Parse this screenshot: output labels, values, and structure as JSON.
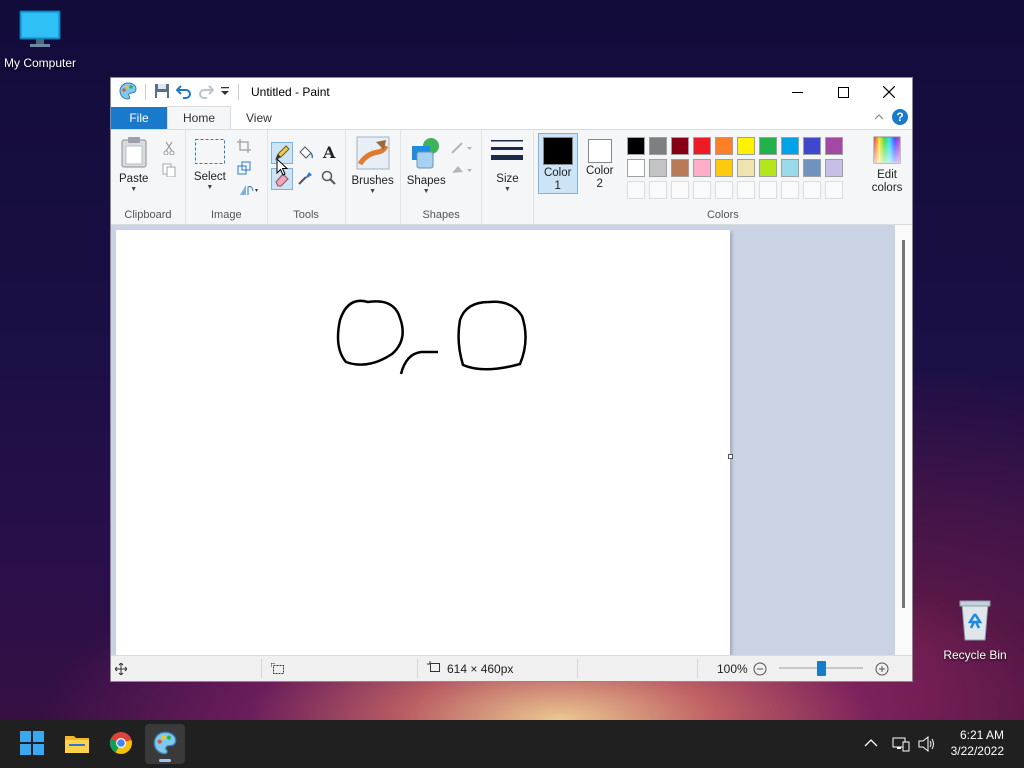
{
  "desktop": {
    "icons": [
      {
        "label": "My Computer"
      },
      {
        "label": "Recycle Bin"
      }
    ]
  },
  "window": {
    "title": "Untitled - Paint",
    "tabs": {
      "file": "File",
      "home": "Home",
      "view": "View"
    }
  },
  "ribbon": {
    "clipboard": {
      "paste_label": "Paste",
      "group_label": "Clipboard"
    },
    "image": {
      "select_label": "Select",
      "group_label": "Image"
    },
    "tools": {
      "group_label": "Tools"
    },
    "brushes": {
      "label": "Brushes"
    },
    "shapes": {
      "label": "Shapes",
      "group_label": "Shapes"
    },
    "size": {
      "label": "Size"
    },
    "color1": {
      "line1": "Color",
      "line2": "1",
      "value": "#000000"
    },
    "color2": {
      "line1": "Color",
      "line2": "2",
      "value": "#ffffff"
    },
    "colors": {
      "group_label": "Colors",
      "edit_line1": "Edit",
      "edit_line2": "colors",
      "row1": [
        "#000000",
        "#7f7f7f",
        "#880015",
        "#ed1c24",
        "#ff7f27",
        "#fff200",
        "#22b14c",
        "#00a2e8",
        "#3f48cc",
        "#a349a4"
      ],
      "row2": [
        "#ffffff",
        "#c3c3c3",
        "#b97a57",
        "#ffaec9",
        "#ffc90e",
        "#efe4b0",
        "#b5e61d",
        "#99d9ea",
        "#7092be",
        "#c8bfe7"
      ]
    }
  },
  "statusbar": {
    "canvas_size": "614 × 460px",
    "zoom": "100%"
  },
  "taskbar": {
    "time": "6:21 AM",
    "date": "3/22/2022"
  }
}
